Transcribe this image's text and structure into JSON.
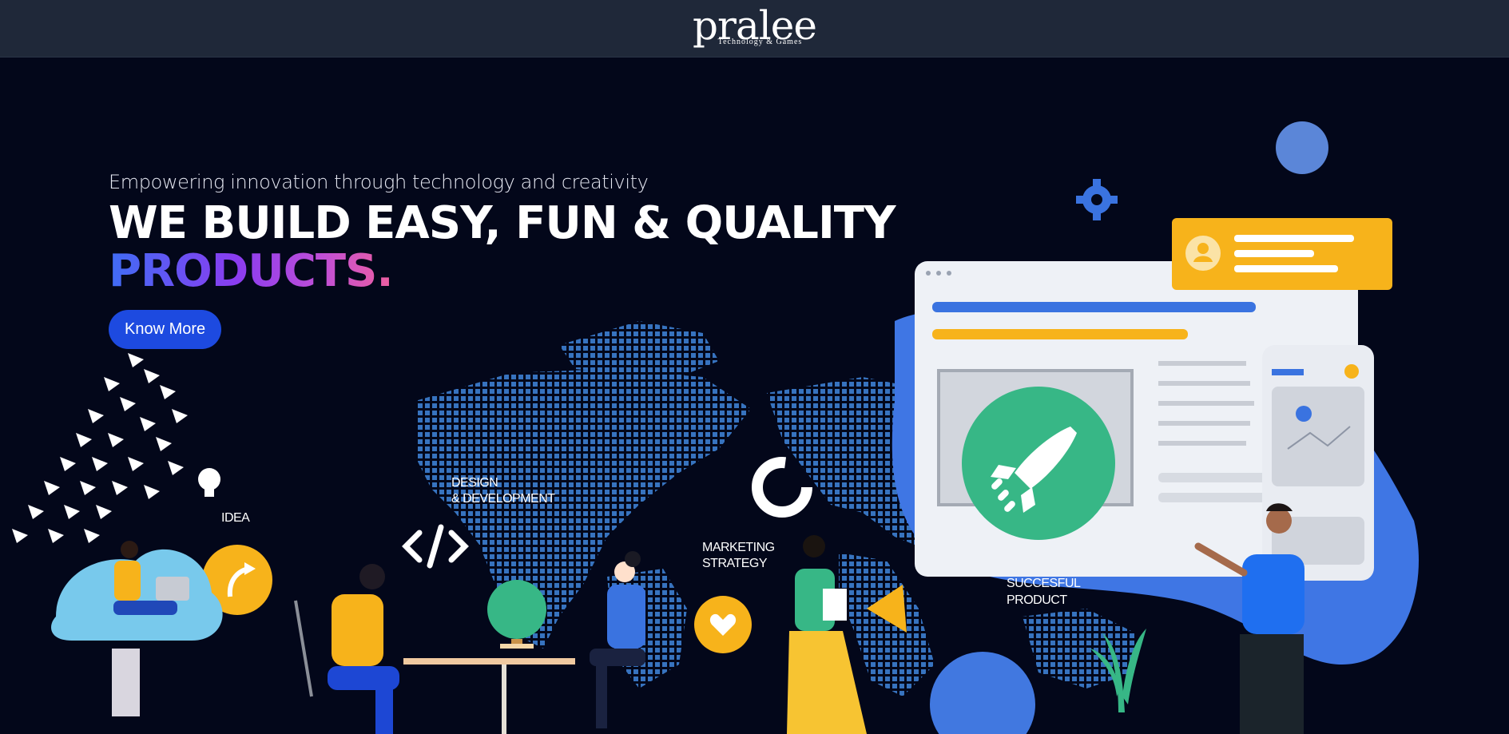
{
  "brand": {
    "name": "pralee",
    "tagline": "Technology & Games"
  },
  "hero": {
    "subtitle": "Empowering innovation through technology and creativity",
    "headline_line1": "WE BUILD EASY, FUN & QUALITY",
    "headline_line2": "PRODUCTS.",
    "cta_label": "Know More"
  },
  "illustration": {
    "labels": {
      "idea": "IDEA",
      "design_line1": "DESIGN",
      "design_line2": "& DEVELOPMENT",
      "marketing_line1": "MARKETING",
      "marketing_line2": "STRATEGY",
      "success_line1": "SUCCESFUL",
      "success_line2": "PRODUCT"
    }
  },
  "colors": {
    "topbar": "#1f2839",
    "background": "#03071a",
    "cta": "#1d4ae0",
    "accent_start": "#3f6df5",
    "accent_end": "#ee5fa0",
    "rocket_green": "#37b786",
    "card_yellow": "#f7b31b"
  },
  "icons": [
    "gear-icon",
    "rocket-icon",
    "user-icon",
    "code-icon",
    "lightbulb-icon",
    "megaphone-icon",
    "heart-icon",
    "arrow-icon"
  ]
}
